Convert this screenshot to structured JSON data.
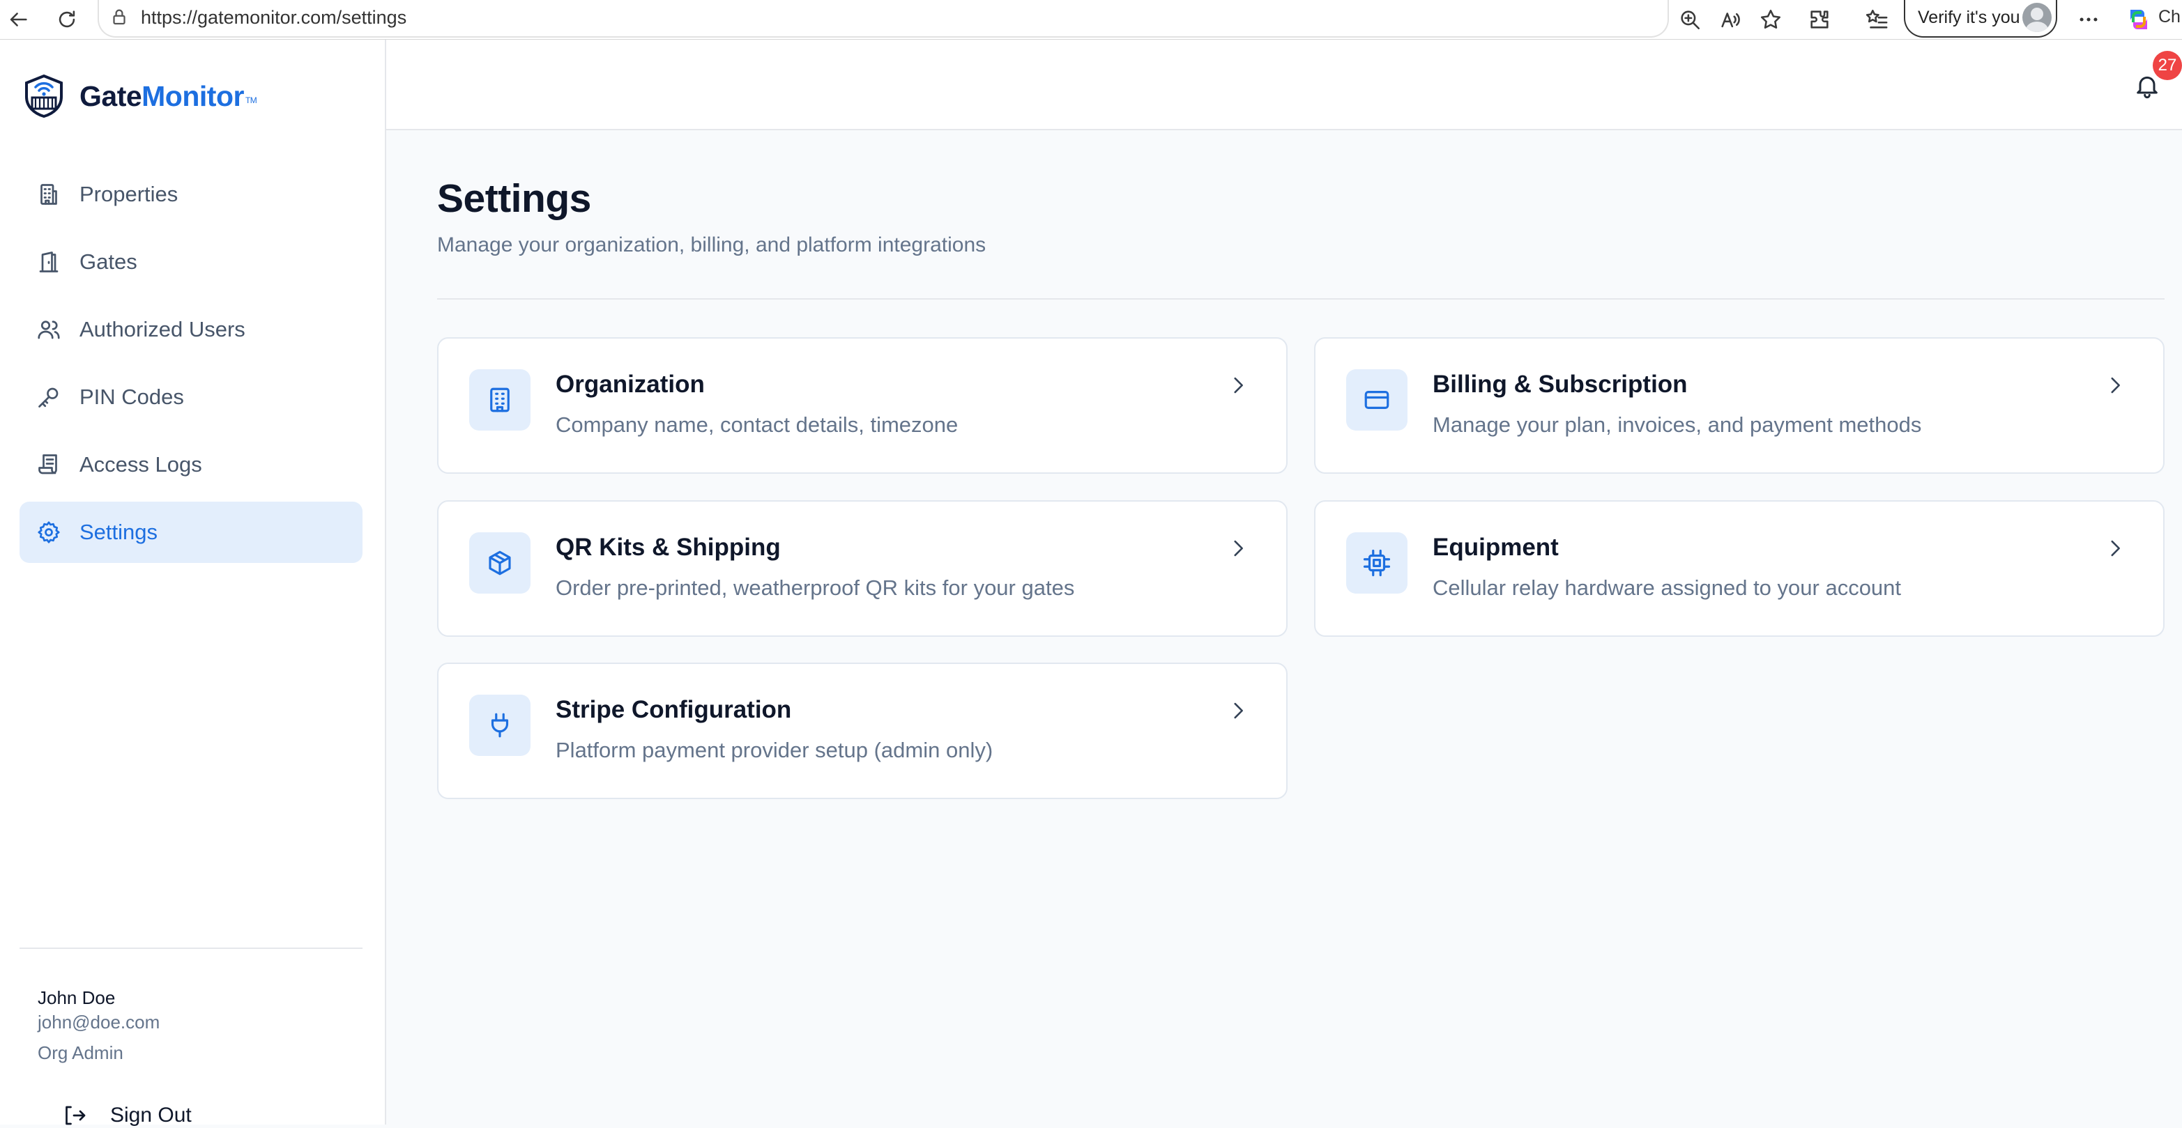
{
  "browser": {
    "url": "https://gatemonitor.com/settings",
    "verify_label": "Verify it's you",
    "copilot_label": "Ch"
  },
  "brand": {
    "name_part1": "Gate",
    "name_part2": "Monitor",
    "trademark": "TM"
  },
  "sidebar": {
    "items": [
      {
        "label": "Properties",
        "icon": "building-icon"
      },
      {
        "label": "Gates",
        "icon": "gate-icon"
      },
      {
        "label": "Authorized Users",
        "icon": "users-icon"
      },
      {
        "label": "PIN Codes",
        "icon": "key-icon"
      },
      {
        "label": "Access Logs",
        "icon": "scroll-icon"
      },
      {
        "label": "Settings",
        "icon": "gear-icon",
        "active": true
      }
    ],
    "user": {
      "name": "John Doe",
      "email": "john@doe.com",
      "role": "Org Admin"
    },
    "sign_out": "Sign Out"
  },
  "header": {
    "notification_count": "27"
  },
  "main": {
    "title": "Settings",
    "subtitle": "Manage your organization, billing, and platform integrations",
    "cards": [
      {
        "title": "Organization",
        "description": "Company name, contact details, timezone",
        "icon": "building-icon"
      },
      {
        "title": "Billing & Subscription",
        "description": "Manage your plan, invoices, and payment methods",
        "icon": "credit-card-icon"
      },
      {
        "title": "QR Kits & Shipping",
        "description": "Order pre-printed, weatherproof QR kits for your gates",
        "icon": "package-icon"
      },
      {
        "title": "Equipment",
        "description": "Cellular relay hardware assigned to your account",
        "icon": "chip-icon"
      },
      {
        "title": "Stripe Configuration",
        "description": "Platform payment provider setup (admin only)",
        "icon": "plug-icon"
      }
    ]
  },
  "colors": {
    "accent": "#1d6fe0",
    "accent_bg": "#e3eefc",
    "badge": "#ef4444"
  }
}
